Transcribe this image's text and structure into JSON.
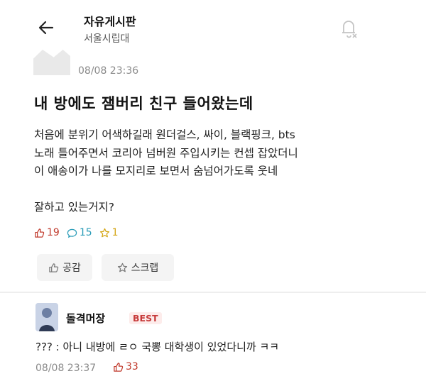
{
  "header": {
    "board_name": "자유게시판",
    "school": "서울시립대",
    "back_icon": "back-arrow-icon",
    "notification_icon": "bell-off-icon"
  },
  "post": {
    "time": "08/08 23:36",
    "title": "내 방에도 잼버리 친구 들어왔는데",
    "body_lines": [
      "처음에 분위기 어색하길래 원더걸스, 싸이, 블랙핑크, bts",
      "노래 틀어주면서 코리아 넘버원 주입시키는 컨셉 잡았더니",
      "이 애송이가 나를 모지리로 보면서 숨넘어가도록 웃네",
      "",
      "잘하고 있는거지?"
    ],
    "likes": "19",
    "comments": "15",
    "scraps": "1",
    "like_button": "공감",
    "scrap_button": "스크랩"
  },
  "comment": {
    "author": "돌격머장",
    "badge": "BEST",
    "text": "??? : 아니 내방에 ㄹㅇ 국뽕 대학생이 있었다니까 ㅋㅋ",
    "time": "08/08 23:37",
    "likes": "33"
  },
  "colors": {
    "likes": "#c0392b",
    "comments": "#2a9cb8",
    "scraps": "#d4a514",
    "best_badge": "#c73b3b"
  }
}
